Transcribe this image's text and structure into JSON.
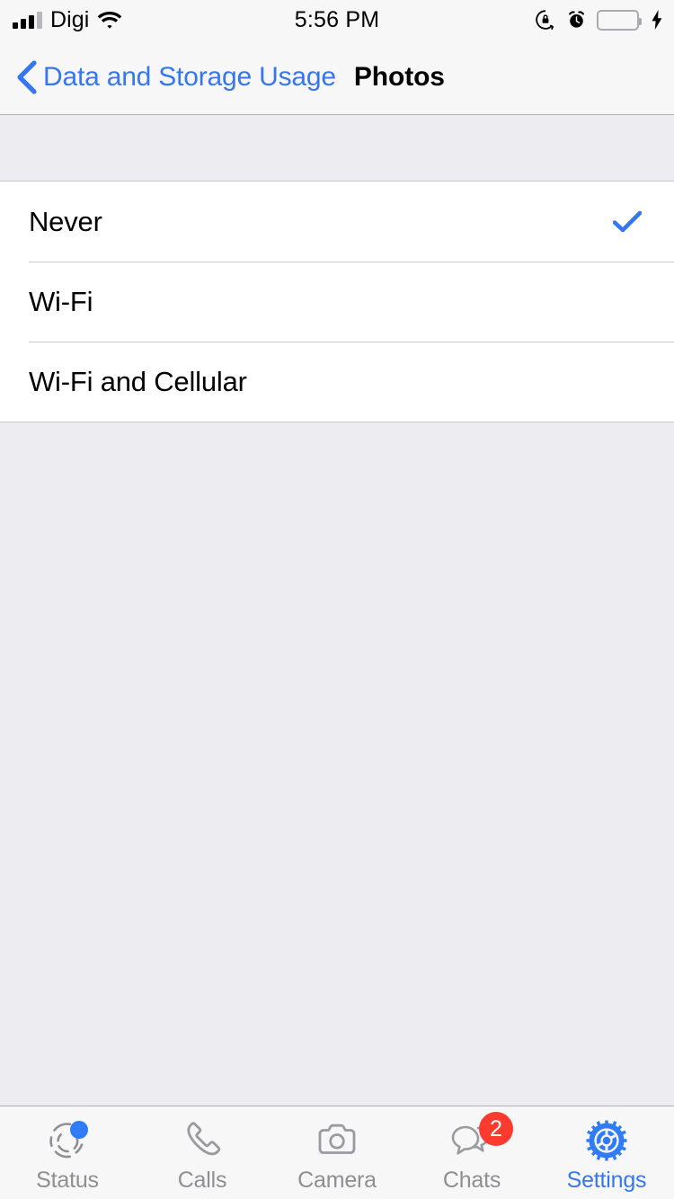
{
  "status_bar": {
    "carrier": "Digi",
    "time": "5:56 PM",
    "signal_bars_filled": 3,
    "signal_bars_total": 4,
    "icons": [
      "signal-icon",
      "wifi-icon",
      "rotation-lock-icon",
      "alarm-clock-icon",
      "battery-icon",
      "charging-bolt-icon"
    ],
    "battery_color": "#4cd761"
  },
  "nav": {
    "back_label": "Data and Storage Usage",
    "title": "Photos",
    "accent_color": "#3577ef"
  },
  "list": {
    "options": [
      {
        "label": "Never",
        "selected": true
      },
      {
        "label": "Wi-Fi",
        "selected": false
      },
      {
        "label": "Wi-Fi and Cellular",
        "selected": false
      }
    ],
    "check_color": "#3577ef"
  },
  "tab_bar": {
    "tabs": [
      {
        "label": "Status",
        "icon": "status-rings-icon",
        "active": false,
        "dot": true
      },
      {
        "label": "Calls",
        "icon": "phone-handset-icon",
        "active": false
      },
      {
        "label": "Camera",
        "icon": "camera-icon",
        "active": false
      },
      {
        "label": "Chats",
        "icon": "chat-bubbles-icon",
        "active": false,
        "badge": "2"
      },
      {
        "label": "Settings",
        "icon": "gear-icon",
        "active": true
      }
    ],
    "active_color": "#3577ef",
    "inactive_color": "#8e8e93",
    "badge_color": "#fb3b30"
  }
}
